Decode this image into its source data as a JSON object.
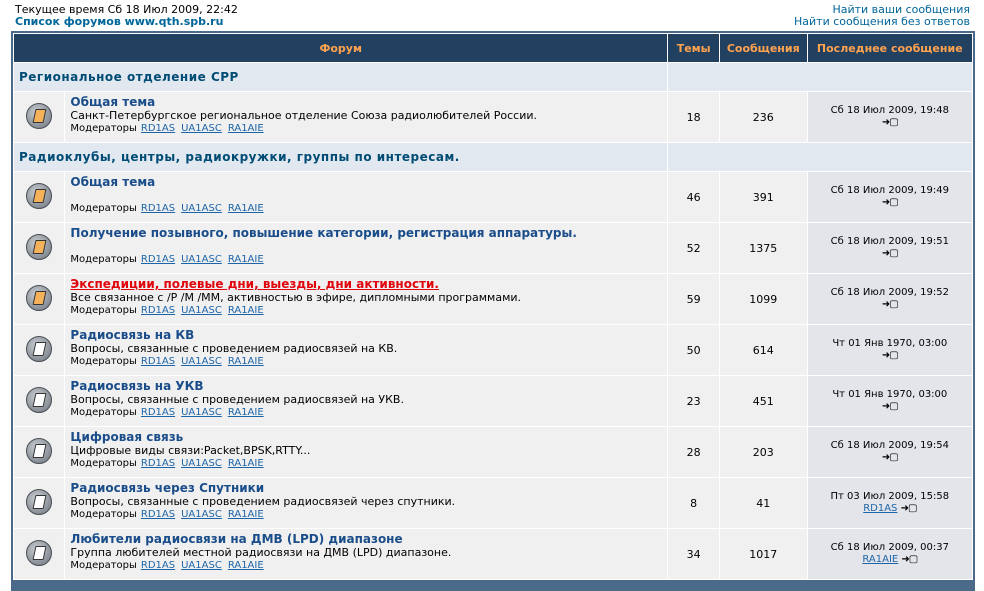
{
  "header": {
    "time": "Текущее время Сб 18 Июл 2009, 22:42",
    "forum_index": "Список форумов www.qth.spb.ru",
    "search_own": "Найти ваши сообщения",
    "search_unanswered": "Найти сообщения без ответов"
  },
  "columns": {
    "forum": "Форум",
    "topics": "Темы",
    "posts": "Сообщения",
    "last": "Последнее сообщение"
  },
  "moderators_label": "Модераторы",
  "moderators": [
    "RD1AS",
    "UA1ASC",
    "RA1AIE"
  ],
  "categories": [
    {
      "title": "Региональное отделение СРР",
      "forums": [
        {
          "title": "Общая тема",
          "desc": "Санкт-Петербургское региональное отделение Союза радиолюбителей России.",
          "topics": "18",
          "posts": "236",
          "last_date": "Сб 18 Июл 2009, 19:48",
          "last_user": "",
          "icon": "new"
        }
      ]
    },
    {
      "title": "Радиоклубы, центры, радиокружки, группы по интересам.",
      "forums": [
        {
          "title": "Общая тема",
          "desc": "",
          "topics": "46",
          "posts": "391",
          "last_date": "Сб 18 Июл 2009, 19:49",
          "last_user": "",
          "icon": "new"
        },
        {
          "title": "Получение позывного, повышение категории, регистрация аппаратуры.",
          "desc": "",
          "topics": "52",
          "posts": "1375",
          "last_date": "Сб 18 Июл 2009, 19:51",
          "last_user": "",
          "icon": "new"
        },
        {
          "title": "Экспедиции, полевые дни, выезды, дни активности.",
          "desc": "Все связанное с /P /M /MM, активностью в эфире, дипломными программами.",
          "topics": "59",
          "posts": "1099",
          "last_date": "Сб 18 Июл 2009, 19:52",
          "last_user": "",
          "icon": "new",
          "hot": true
        },
        {
          "title": "Радиосвязь на КВ",
          "desc": "Вопросы, связанные с проведением радиосвязей на КВ.",
          "topics": "50",
          "posts": "614",
          "last_date": "Чт 01 Янв 1970, 03:00",
          "last_user": "",
          "icon": "read"
        },
        {
          "title": "Радиосвязь на УКВ",
          "desc": "Вопросы, связанные с проведением радиосвязей на УКВ.",
          "topics": "23",
          "posts": "451",
          "last_date": "Чт 01 Янв 1970, 03:00",
          "last_user": "",
          "icon": "read"
        },
        {
          "title": "Цифровая связь",
          "desc": "Цифровые виды связи:Packet,BPSK,RTTY...",
          "topics": "28",
          "posts": "203",
          "last_date": "Сб 18 Июл 2009, 19:54",
          "last_user": "",
          "icon": "read"
        },
        {
          "title": "Радиосвязь через Спутники",
          "desc": "Вопросы, связанные с проведением радиосвязей через спутники.",
          "topics": "8",
          "posts": "41",
          "last_date": "Пт 03 Июл 2009, 15:58",
          "last_user": "RD1AS",
          "icon": "read"
        },
        {
          "title": "Любители радиосвязи на ДМВ (LPD) диапазоне",
          "desc": "Группа любителей местной радиосвязи на ДМВ (LPD) диапазоне.",
          "topics": "34",
          "posts": "1017",
          "last_date": "Сб 18 Июл 2009, 00:37",
          "last_user": "RA1AIE",
          "icon": "read"
        }
      ]
    }
  ],
  "colors": {
    "header_bg": "#224060",
    "header_text": "#ffa34f",
    "link": "#1a4d8a",
    "hot": "#e0060e",
    "category_bg": "#e1e8f0",
    "row_bg": "#f0f0f0"
  }
}
